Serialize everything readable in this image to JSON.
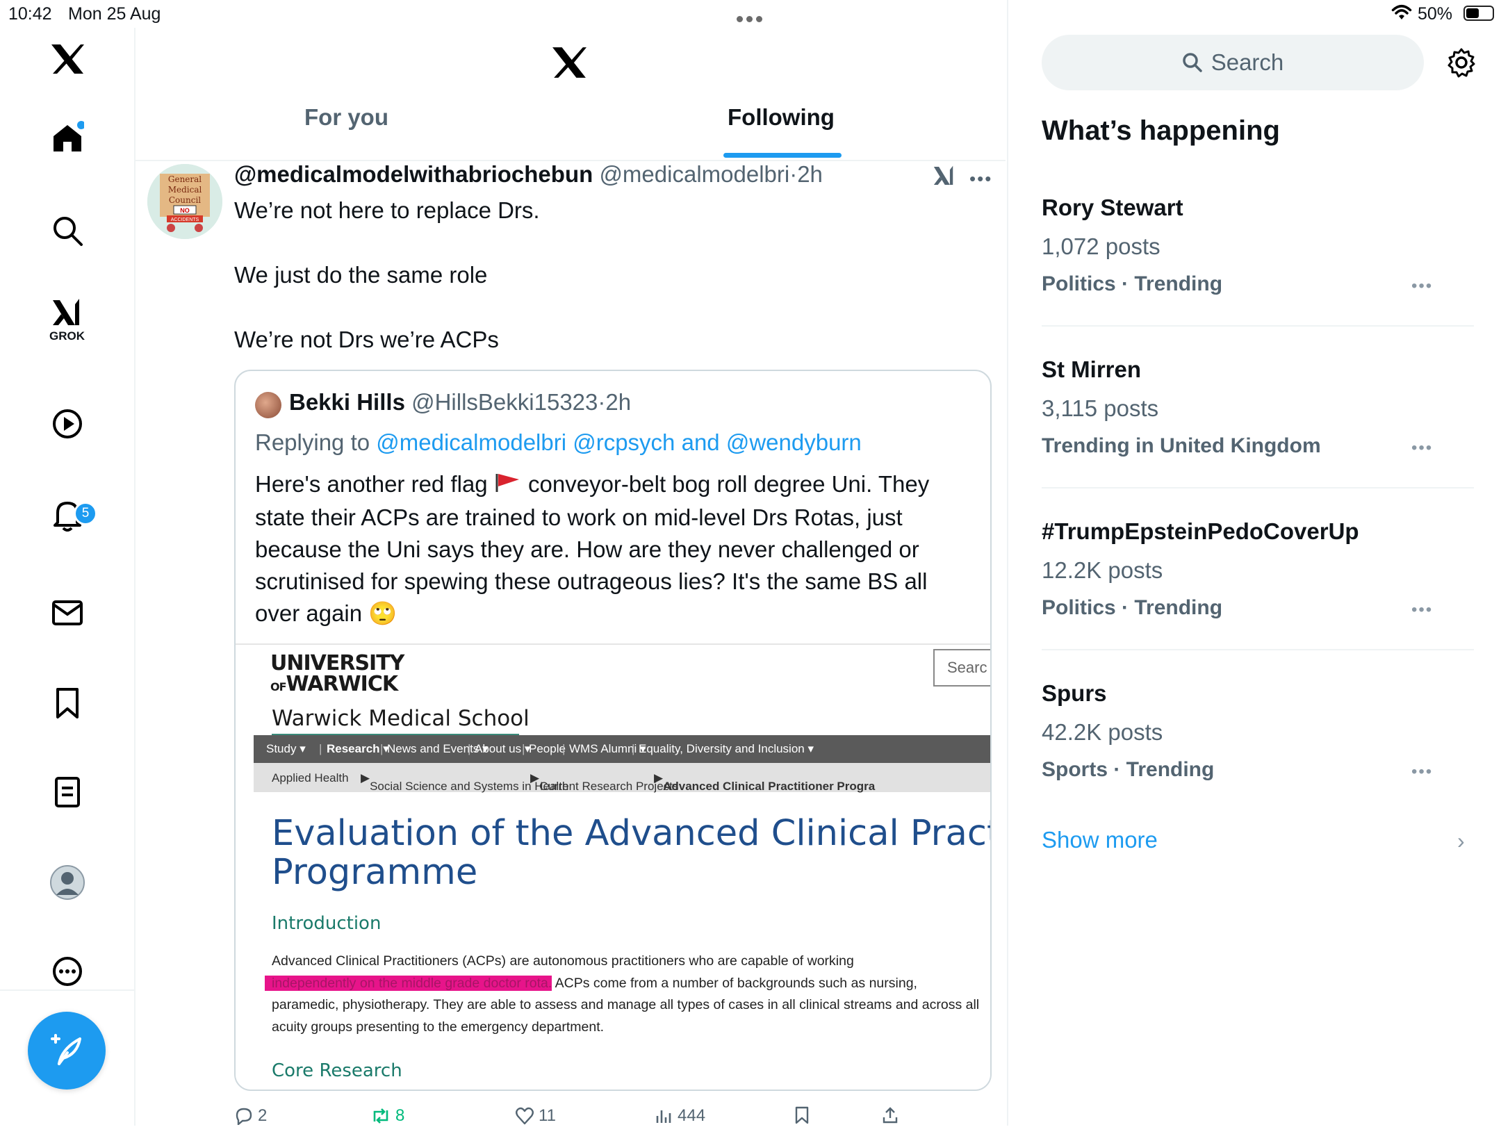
{
  "status_bar": {
    "time": "10:42",
    "date": "Mon 25 Aug",
    "battery": "50%"
  },
  "left_nav": {
    "notifications_badge": "5",
    "grok_label": "GROK"
  },
  "tabs": [
    {
      "label": "For you",
      "active": false
    },
    {
      "label": "Following",
      "active": true
    }
  ],
  "tweet": {
    "display_name": "@medicalmodelwithabriochebun",
    "handle": "@medicalmodelbri",
    "time": "2h",
    "lines": [
      "We’re not here to replace Drs.",
      "We just do the same role",
      "We’re not Drs we’re ACPs"
    ],
    "avatar_text": [
      "General",
      "Medical",
      "Council",
      "NO",
      "ACCIDENTS"
    ],
    "quote": {
      "display_name": "Bekki Hills",
      "handle": "@HillsBekki15323",
      "time": "2h",
      "replying_prefix": "Replying to",
      "replying_to_1": "@medicalmodelbri",
      "replying_to_2": "@rcpsych",
      "replying_and": "and",
      "replying_to_3": "@wendyburn",
      "text_before_flag": "Here's another red flag",
      "text_after_flag": " conveyor-belt bog roll degree Uni. They state their ACPs are trained to work on mid-level Drs Rotas, just because the Uni says they are. How are they never challenged or scrutinised for spewing these outrageous lies? It's the same BS all over again",
      "emoji": "🙄",
      "screenshot": {
        "logo_line1": "UNIVERSITY",
        "logo_of": "OF",
        "logo_line2": "WARWICK",
        "search_placeholder": "Searc",
        "school": "Warwick Medical School",
        "nav": [
          "Study ▾",
          "Research ▾",
          "News and Events ▾",
          "About us ▾",
          "People",
          "WMS Alumni ▾",
          "Equality, Diversity and Inclusion ▾"
        ],
        "breadcrumb": [
          "Applied Health",
          "Social Science and Systems in Health",
          "Current Research Projects",
          "Advanced Clinical Practitioner Progra"
        ],
        "title_line1": "Evaluation of the Advanced Clinical Practit",
        "title_line2": "Programme",
        "intro_heading": "Introduction",
        "para_before": "Advanced Clinical Practitioners (ACPs) are autonomous practitioners who are capable of working",
        "para_highlight": "independently on the middle grade doctor rota.",
        "para_after": " ACPs come from a number of backgrounds such as nursing, paramedic, physiotherapy. They are able to assess and manage all types of cases in all clinical streams and across all acuity groups presenting to the emergency department.",
        "core_heading": "Core Research"
      }
    },
    "actions": {
      "replies": "2",
      "reposts": "8",
      "likes": "11",
      "views": "444"
    }
  },
  "right_panel": {
    "search_placeholder": "Search",
    "title": "What’s happening",
    "trends": [
      {
        "name": "Rory Stewart",
        "posts": "1,072 posts",
        "category": "Politics · Trending"
      },
      {
        "name": "St Mirren",
        "posts": "3,115 posts",
        "category": "Trending in United Kingdom"
      },
      {
        "name": "#TrumpEpsteinPedoCoverUp",
        "posts": "12.2K posts",
        "category": "Politics · Trending"
      },
      {
        "name": "Spurs",
        "posts": "42.2K posts",
        "category": "Sports · Trending"
      }
    ],
    "show_more": "Show more"
  },
  "colors": {
    "accent": "#1d9bf0",
    "secondary_text": "#536471",
    "repost_green": "#00ba7c",
    "highlight_pink": "#e7148a"
  }
}
